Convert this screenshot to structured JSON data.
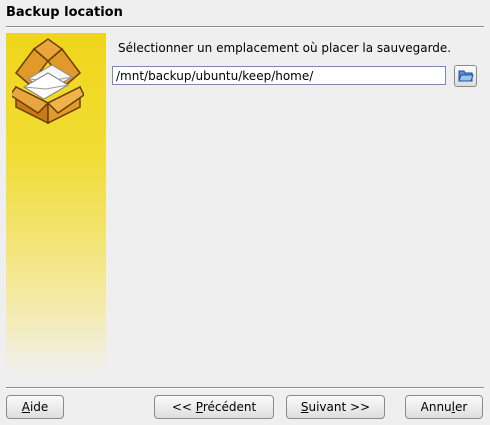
{
  "wizard": {
    "title": "Backup location"
  },
  "content": {
    "instruction": "Sélectionner un emplacement où placer la sauvegarde.",
    "path_value": "/mnt/backup/ubuntu/keep/home/"
  },
  "buttons": {
    "help": {
      "mnemonic": "A",
      "rest": "ide"
    },
    "prev": {
      "before": "<< ",
      "mnemonic": "P",
      "rest": "récédent"
    },
    "next": {
      "mnemonic": "S",
      "rest": "uivant >>"
    },
    "cancel": {
      "before": "Annu",
      "mnemonic": "l",
      "rest": "er"
    }
  },
  "icons": {
    "banner": "package-box-envelopes-icon",
    "browse": "folder-open-icon"
  },
  "colors": {
    "background": "#efefef",
    "banner_yellow": "#efd61c",
    "box_orange": "#d88a1c",
    "folder_blue": "#3a78c8"
  }
}
